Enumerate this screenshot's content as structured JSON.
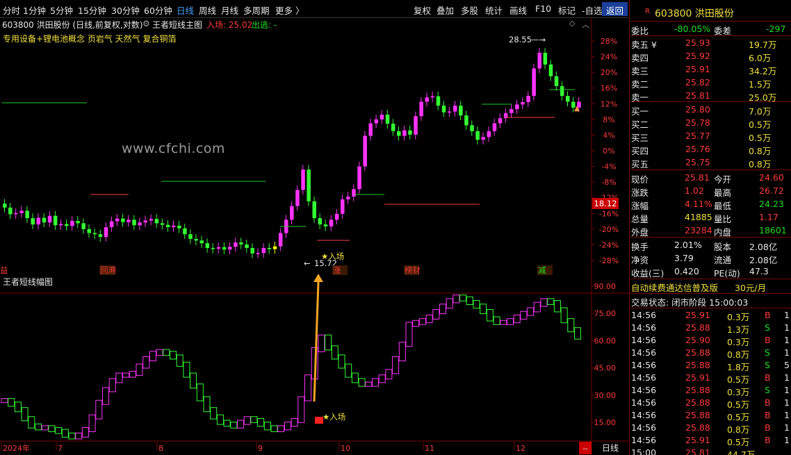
{
  "toolbar": {
    "items": [
      "分时",
      "1分钟",
      "5分钟",
      "15分钟",
      "30分钟",
      "60分钟",
      "日线",
      "周线",
      "月线",
      "多周期",
      "更多 〉"
    ],
    "active": "日线",
    "right_items": [
      "复权",
      "叠加",
      "多股",
      "统计",
      "画线",
      "F10",
      "标记",
      "-自选"
    ],
    "return_label": "返回"
  },
  "header": {
    "stock_info": "603800 洪田股份 (日线,前复权,对数)",
    "indicator_name": "王者短线主图",
    "entry_label": "入场: 25.02",
    "exit_label": "出逃: -",
    "concepts": "专用设备+锂电池概念 页岩气 天然气 复合铜箔",
    "watermark": "www.cfchi.com"
  },
  "chart": {
    "y_labels_pct": [
      "28%",
      "24%",
      "20%",
      "16%",
      "12%",
      "8%",
      "4%",
      "0%",
      "-4%",
      "-8%",
      "-12%",
      "-16%",
      "-20%",
      "-24%",
      "-28%"
    ],
    "current_price_tag": "18.12",
    "high_label": "28.55",
    "low_label": "15.72",
    "entry_marker": "★入场",
    "events": [
      "回溯",
      "涨",
      "榜财",
      "减"
    ],
    "sub_title": "王者短线幅图",
    "sub_y_labels": [
      "90.00",
      "75.00",
      "60.00",
      "45.00",
      "30.00",
      "15.00"
    ],
    "sub_entry_marker": "★入场",
    "x_labels": [
      "2024年",
      "7",
      "8",
      "9",
      "10",
      "11",
      "12"
    ],
    "period_button": "日线",
    "colors": {
      "up": "#ff33ff",
      "down": "#33ff33",
      "entry": "#ffff00"
    },
    "candles": [
      [
        0,
        -14.5
      ],
      [
        1,
        -16.2
      ],
      [
        2,
        -15.9
      ],
      [
        3,
        -15.3
      ],
      [
        4,
        -17.2
      ],
      [
        5,
        -18.8
      ],
      [
        6,
        -17.1
      ],
      [
        7,
        -18.3
      ],
      [
        8,
        -16.6
      ],
      [
        9,
        -19.0
      ],
      [
        10,
        -18.7
      ],
      [
        11,
        -19.2
      ],
      [
        12,
        -17.9
      ],
      [
        13,
        -18.5
      ],
      [
        14,
        -20.0
      ],
      [
        15,
        -21.0
      ],
      [
        16,
        -21.3
      ],
      [
        17,
        -22.0
      ],
      [
        18,
        -19.5
      ],
      [
        19,
        -18.0
      ],
      [
        20,
        -17.3
      ],
      [
        21,
        -18.2
      ],
      [
        22,
        -17.6
      ],
      [
        23,
        -19.0
      ],
      [
        24,
        -18.3
      ],
      [
        25,
        -17.8
      ],
      [
        26,
        -17.4
      ],
      [
        27,
        -18.5
      ],
      [
        28,
        -18.9
      ],
      [
        29,
        -19.5
      ],
      [
        30,
        -19.1
      ],
      [
        31,
        -19.8
      ],
      [
        32,
        -21.3
      ],
      [
        33,
        -22.5
      ],
      [
        34,
        -22.9
      ],
      [
        35,
        -23.6
      ],
      [
        36,
        -24.8
      ],
      [
        37,
        -25.0
      ],
      [
        38,
        -24.6
      ],
      [
        39,
        -25.2
      ],
      [
        40,
        -24.5
      ],
      [
        41,
        -23.4
      ],
      [
        42,
        -23.9
      ],
      [
        43,
        -24.8
      ],
      [
        44,
        -26.2
      ],
      [
        45,
        -26.1
      ],
      [
        46,
        -24.8
      ],
      [
        47,
        -25.1
      ],
      [
        48,
        -24.4
      ],
      [
        49,
        -21.0
      ],
      [
        50,
        -17.6
      ],
      [
        51,
        -14.1
      ],
      [
        52,
        -10.0
      ],
      [
        53,
        -4.8
      ],
      [
        54,
        -12.9
      ],
      [
        55,
        -17.2
      ],
      [
        56,
        -18.8
      ],
      [
        57,
        -19.3
      ],
      [
        58,
        -17.6
      ],
      [
        59,
        -16.1
      ],
      [
        60,
        -12.4
      ],
      [
        61,
        -11.7
      ],
      [
        62,
        -9.8
      ],
      [
        63,
        -4.0
      ],
      [
        64,
        3.8
      ],
      [
        65,
        7.0
      ],
      [
        66,
        8.0
      ],
      [
        67,
        9.2
      ],
      [
        68,
        6.9
      ],
      [
        69,
        5.0
      ],
      [
        70,
        3.8
      ],
      [
        71,
        5.2
      ],
      [
        72,
        4.1
      ],
      [
        73,
        8.8
      ],
      [
        74,
        12.5
      ],
      [
        75,
        13.6
      ],
      [
        76,
        13.9
      ],
      [
        77,
        11.5
      ],
      [
        78,
        9.8
      ],
      [
        79,
        10.0
      ],
      [
        80,
        11.5
      ],
      [
        81,
        9.0
      ],
      [
        82,
        6.5
      ],
      [
        83,
        5.0
      ],
      [
        84,
        2.8
      ],
      [
        85,
        3.5
      ],
      [
        86,
        5.0
      ],
      [
        87,
        7.0
      ],
      [
        88,
        8.3
      ],
      [
        89,
        9.6
      ],
      [
        90,
        10.6
      ],
      [
        91,
        11.8
      ],
      [
        92,
        12.4
      ],
      [
        93,
        14.0
      ],
      [
        94,
        21.0
      ],
      [
        95,
        25.0
      ],
      [
        96,
        22.0
      ],
      [
        97,
        19.0
      ],
      [
        98,
        16.5
      ],
      [
        99,
        14.0
      ],
      [
        100,
        12.5
      ],
      [
        101,
        11.0
      ],
      [
        102,
        12.5
      ]
    ],
    "sub_series": [
      [
        0,
        27
      ],
      [
        1,
        25
      ],
      [
        2,
        22
      ],
      [
        3,
        17
      ],
      [
        4,
        13
      ],
      [
        5,
        12
      ],
      [
        6,
        12
      ],
      [
        7,
        11
      ],
      [
        8,
        10
      ],
      [
        9,
        8
      ],
      [
        10,
        7
      ],
      [
        11,
        8
      ],
      [
        12,
        11
      ],
      [
        13,
        18
      ],
      [
        14,
        26
      ],
      [
        15,
        33
      ],
      [
        16,
        38
      ],
      [
        17,
        41
      ],
      [
        18,
        41
      ],
      [
        19,
        42
      ],
      [
        20,
        46
      ],
      [
        21,
        50
      ],
      [
        22,
        53
      ],
      [
        23,
        54
      ],
      [
        24,
        53
      ],
      [
        25,
        51
      ],
      [
        26,
        47
      ],
      [
        27,
        41
      ],
      [
        28,
        35
      ],
      [
        29,
        28
      ],
      [
        30,
        22
      ],
      [
        31,
        18
      ],
      [
        32,
        15
      ],
      [
        33,
        14
      ],
      [
        34,
        13
      ],
      [
        35,
        15
      ],
      [
        36,
        17
      ],
      [
        37,
        16
      ],
      [
        38,
        14
      ],
      [
        39,
        12
      ],
      [
        40,
        11
      ],
      [
        41,
        12
      ],
      [
        42,
        14
      ],
      [
        43,
        16
      ],
      [
        44,
        28
      ],
      [
        45,
        40
      ],
      [
        46,
        55
      ],
      [
        47,
        62
      ],
      [
        48,
        56
      ],
      [
        49,
        51
      ],
      [
        50,
        46
      ],
      [
        51,
        41
      ],
      [
        52,
        38
      ],
      [
        53,
        36
      ],
      [
        54,
        36
      ],
      [
        55,
        38
      ],
      [
        56,
        40
      ],
      [
        57,
        43
      ],
      [
        58,
        50
      ],
      [
        59,
        58
      ],
      [
        60,
        69
      ],
      [
        61,
        70
      ],
      [
        62,
        71
      ],
      [
        63,
        73
      ],
      [
        64,
        76
      ],
      [
        65,
        79
      ],
      [
        66,
        82
      ],
      [
        67,
        84
      ],
      [
        68,
        83
      ],
      [
        69,
        81
      ],
      [
        70,
        79
      ],
      [
        71,
        76
      ],
      [
        72,
        72
      ],
      [
        73,
        70
      ],
      [
        74,
        70
      ],
      [
        75,
        71
      ],
      [
        76,
        73
      ],
      [
        77,
        75
      ],
      [
        78,
        77
      ],
      [
        79,
        80
      ],
      [
        80,
        82
      ],
      [
        81,
        81
      ],
      [
        82,
        77
      ],
      [
        83,
        71
      ],
      [
        84,
        66
      ],
      [
        85,
        62
      ]
    ]
  },
  "quote": {
    "symbol_badge": "R",
    "code_name": "603800 洪田股份",
    "weibi_label": "委比",
    "weibi": "-80.05%",
    "weicha_label": "委差",
    "weicha": "-297",
    "asks": [
      {
        "label": "卖五 ¥",
        "price": "25.93",
        "vol": "19.7万"
      },
      {
        "label": "卖四",
        "price": "25.92",
        "vol": "6.0万"
      },
      {
        "label": "卖三",
        "price": "25.91",
        "vol": "34.2万"
      },
      {
        "label": "卖二",
        "price": "25.82",
        "vol": "1.5万"
      },
      {
        "label": "卖一",
        "price": "25.81",
        "vol": "25.0万"
      }
    ],
    "bids": [
      {
        "label": "买一",
        "price": "25.80",
        "vol": "7.0万"
      },
      {
        "label": "买二",
        "price": "25.78",
        "vol": "0.5万"
      },
      {
        "label": "买三",
        "price": "25.77",
        "vol": "0.5万"
      },
      {
        "label": "买四",
        "price": "25.76",
        "vol": "0.8万"
      },
      {
        "label": "买五",
        "price": "25.75",
        "vol": "0.8万"
      }
    ],
    "stats": [
      {
        "l1": "现价",
        "v1": "25.81",
        "c1": "red",
        "l2": "今开",
        "v2": "24.60",
        "c2": "red"
      },
      {
        "l1": "涨跌",
        "v1": "1.02",
        "c1": "red",
        "l2": "最高",
        "v2": "26.72",
        "c2": "red"
      },
      {
        "l1": "涨幅",
        "v1": "4.11%",
        "c1": "red",
        "l2": "最低",
        "v2": "24.23",
        "c2": "green"
      },
      {
        "l1": "总量",
        "v1": "41885",
        "c1": "yellow",
        "l2": "量比",
        "v2": "1.17",
        "c2": "red"
      },
      {
        "l1": "外盘",
        "v1": "23284",
        "c1": "red",
        "l2": "内盘",
        "v2": "18601",
        "c2": "green"
      }
    ],
    "stats2": [
      {
        "l1": "换手",
        "v1": "2.01%",
        "l2": "股本",
        "v2": "2.08亿"
      },
      {
        "l1": "净资",
        "v1": "3.79",
        "l2": "流通",
        "v2": "2.08亿"
      },
      {
        "l1": "收益(三)",
        "v1": "0.420",
        "l2": "PE(动)",
        "v2": "47.3"
      }
    ],
    "service": "自动续费通达信普及版",
    "service_price": "30元/月",
    "trade_status": "交易状态: 闭市阶段 15:00:03",
    "ticks": [
      {
        "t": "14:56",
        "p": "25.91",
        "v": "0.3万",
        "s": "B",
        "n": "1"
      },
      {
        "t": "14:56",
        "p": "25.88",
        "v": "1.3万",
        "s": "S",
        "n": "1"
      },
      {
        "t": "14:56",
        "p": "25.90",
        "v": "0.3万",
        "s": "B",
        "n": "1"
      },
      {
        "t": "14:56",
        "p": "25.88",
        "v": "0.8万",
        "s": "S",
        "n": "1"
      },
      {
        "t": "14:56",
        "p": "25.88",
        "v": "1.8万",
        "s": "S",
        "n": "5"
      },
      {
        "t": "14:56",
        "p": "25.91",
        "v": "0.5万",
        "s": "B",
        "n": "1"
      },
      {
        "t": "14:56",
        "p": "25.88",
        "v": "0.3万",
        "s": "S",
        "n": "1"
      },
      {
        "t": "14:56",
        "p": "25.88",
        "v": "0.5万",
        "s": "B",
        "n": "1"
      },
      {
        "t": "14:56",
        "p": "25.88",
        "v": "0.5万",
        "s": "B",
        "n": "1"
      },
      {
        "t": "14:56",
        "p": "25.88",
        "v": "0.8万",
        "s": "B",
        "n": "1"
      },
      {
        "t": "14:56",
        "p": "25.91",
        "v": "0.5万",
        "s": "B",
        "n": "1"
      },
      {
        "t": "15:00",
        "p": "25.81",
        "v": "44.7万",
        "s": "",
        "n": ""
      }
    ]
  }
}
